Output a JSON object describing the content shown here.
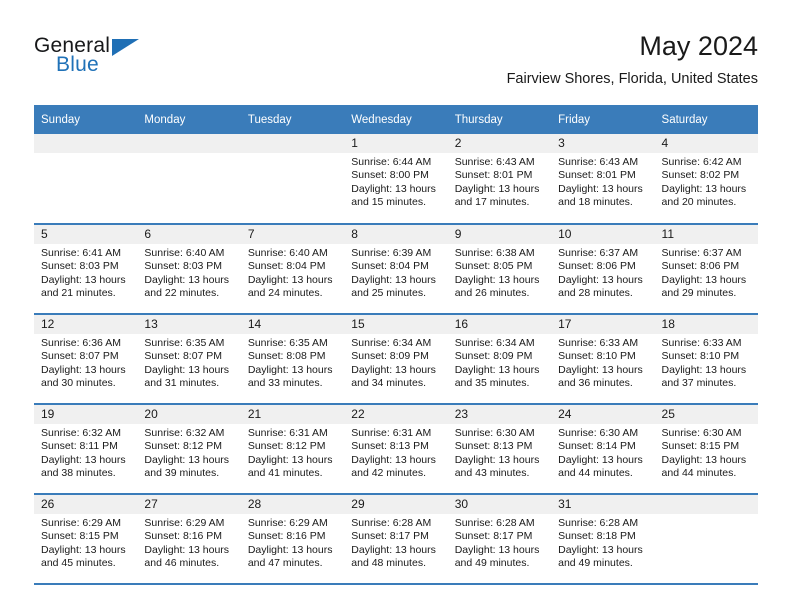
{
  "brand": {
    "name_part1": "General",
    "name_part2": "Blue",
    "triangle_color": "#1f6fb5"
  },
  "header": {
    "month_title": "May 2024",
    "location": "Fairview Shores, Florida, United States"
  },
  "colors": {
    "header_blue": "#3a7cba",
    "daynum_band": "#f0f0f0",
    "text": "#1a1a1a"
  },
  "weekday_headers": [
    "Sunday",
    "Monday",
    "Tuesday",
    "Wednesday",
    "Thursday",
    "Friday",
    "Saturday"
  ],
  "weeks": [
    [
      {
        "day": "",
        "sunrise": "",
        "sunset": "",
        "daylight_line1": "",
        "daylight_line2": "",
        "empty": true
      },
      {
        "day": "",
        "sunrise": "",
        "sunset": "",
        "daylight_line1": "",
        "daylight_line2": "",
        "empty": true
      },
      {
        "day": "",
        "sunrise": "",
        "sunset": "",
        "daylight_line1": "",
        "daylight_line2": "",
        "empty": true
      },
      {
        "day": "1",
        "sunrise": "Sunrise: 6:44 AM",
        "sunset": "Sunset: 8:00 PM",
        "daylight_line1": "Daylight: 13 hours",
        "daylight_line2": "and 15 minutes."
      },
      {
        "day": "2",
        "sunrise": "Sunrise: 6:43 AM",
        "sunset": "Sunset: 8:01 PM",
        "daylight_line1": "Daylight: 13 hours",
        "daylight_line2": "and 17 minutes."
      },
      {
        "day": "3",
        "sunrise": "Sunrise: 6:43 AM",
        "sunset": "Sunset: 8:01 PM",
        "daylight_line1": "Daylight: 13 hours",
        "daylight_line2": "and 18 minutes."
      },
      {
        "day": "4",
        "sunrise": "Sunrise: 6:42 AM",
        "sunset": "Sunset: 8:02 PM",
        "daylight_line1": "Daylight: 13 hours",
        "daylight_line2": "and 20 minutes."
      }
    ],
    [
      {
        "day": "5",
        "sunrise": "Sunrise: 6:41 AM",
        "sunset": "Sunset: 8:03 PM",
        "daylight_line1": "Daylight: 13 hours",
        "daylight_line2": "and 21 minutes."
      },
      {
        "day": "6",
        "sunrise": "Sunrise: 6:40 AM",
        "sunset": "Sunset: 8:03 PM",
        "daylight_line1": "Daylight: 13 hours",
        "daylight_line2": "and 22 minutes."
      },
      {
        "day": "7",
        "sunrise": "Sunrise: 6:40 AM",
        "sunset": "Sunset: 8:04 PM",
        "daylight_line1": "Daylight: 13 hours",
        "daylight_line2": "and 24 minutes."
      },
      {
        "day": "8",
        "sunrise": "Sunrise: 6:39 AM",
        "sunset": "Sunset: 8:04 PM",
        "daylight_line1": "Daylight: 13 hours",
        "daylight_line2": "and 25 minutes."
      },
      {
        "day": "9",
        "sunrise": "Sunrise: 6:38 AM",
        "sunset": "Sunset: 8:05 PM",
        "daylight_line1": "Daylight: 13 hours",
        "daylight_line2": "and 26 minutes."
      },
      {
        "day": "10",
        "sunrise": "Sunrise: 6:37 AM",
        "sunset": "Sunset: 8:06 PM",
        "daylight_line1": "Daylight: 13 hours",
        "daylight_line2": "and 28 minutes."
      },
      {
        "day": "11",
        "sunrise": "Sunrise: 6:37 AM",
        "sunset": "Sunset: 8:06 PM",
        "daylight_line1": "Daylight: 13 hours",
        "daylight_line2": "and 29 minutes."
      }
    ],
    [
      {
        "day": "12",
        "sunrise": "Sunrise: 6:36 AM",
        "sunset": "Sunset: 8:07 PM",
        "daylight_line1": "Daylight: 13 hours",
        "daylight_line2": "and 30 minutes."
      },
      {
        "day": "13",
        "sunrise": "Sunrise: 6:35 AM",
        "sunset": "Sunset: 8:07 PM",
        "daylight_line1": "Daylight: 13 hours",
        "daylight_line2": "and 31 minutes."
      },
      {
        "day": "14",
        "sunrise": "Sunrise: 6:35 AM",
        "sunset": "Sunset: 8:08 PM",
        "daylight_line1": "Daylight: 13 hours",
        "daylight_line2": "and 33 minutes."
      },
      {
        "day": "15",
        "sunrise": "Sunrise: 6:34 AM",
        "sunset": "Sunset: 8:09 PM",
        "daylight_line1": "Daylight: 13 hours",
        "daylight_line2": "and 34 minutes."
      },
      {
        "day": "16",
        "sunrise": "Sunrise: 6:34 AM",
        "sunset": "Sunset: 8:09 PM",
        "daylight_line1": "Daylight: 13 hours",
        "daylight_line2": "and 35 minutes."
      },
      {
        "day": "17",
        "sunrise": "Sunrise: 6:33 AM",
        "sunset": "Sunset: 8:10 PM",
        "daylight_line1": "Daylight: 13 hours",
        "daylight_line2": "and 36 minutes."
      },
      {
        "day": "18",
        "sunrise": "Sunrise: 6:33 AM",
        "sunset": "Sunset: 8:10 PM",
        "daylight_line1": "Daylight: 13 hours",
        "daylight_line2": "and 37 minutes."
      }
    ],
    [
      {
        "day": "19",
        "sunrise": "Sunrise: 6:32 AM",
        "sunset": "Sunset: 8:11 PM",
        "daylight_line1": "Daylight: 13 hours",
        "daylight_line2": "and 38 minutes."
      },
      {
        "day": "20",
        "sunrise": "Sunrise: 6:32 AM",
        "sunset": "Sunset: 8:12 PM",
        "daylight_line1": "Daylight: 13 hours",
        "daylight_line2": "and 39 minutes."
      },
      {
        "day": "21",
        "sunrise": "Sunrise: 6:31 AM",
        "sunset": "Sunset: 8:12 PM",
        "daylight_line1": "Daylight: 13 hours",
        "daylight_line2": "and 41 minutes."
      },
      {
        "day": "22",
        "sunrise": "Sunrise: 6:31 AM",
        "sunset": "Sunset: 8:13 PM",
        "daylight_line1": "Daylight: 13 hours",
        "daylight_line2": "and 42 minutes."
      },
      {
        "day": "23",
        "sunrise": "Sunrise: 6:30 AM",
        "sunset": "Sunset: 8:13 PM",
        "daylight_line1": "Daylight: 13 hours",
        "daylight_line2": "and 43 minutes."
      },
      {
        "day": "24",
        "sunrise": "Sunrise: 6:30 AM",
        "sunset": "Sunset: 8:14 PM",
        "daylight_line1": "Daylight: 13 hours",
        "daylight_line2": "and 44 minutes."
      },
      {
        "day": "25",
        "sunrise": "Sunrise: 6:30 AM",
        "sunset": "Sunset: 8:15 PM",
        "daylight_line1": "Daylight: 13 hours",
        "daylight_line2": "and 44 minutes."
      }
    ],
    [
      {
        "day": "26",
        "sunrise": "Sunrise: 6:29 AM",
        "sunset": "Sunset: 8:15 PM",
        "daylight_line1": "Daylight: 13 hours",
        "daylight_line2": "and 45 minutes."
      },
      {
        "day": "27",
        "sunrise": "Sunrise: 6:29 AM",
        "sunset": "Sunset: 8:16 PM",
        "daylight_line1": "Daylight: 13 hours",
        "daylight_line2": "and 46 minutes."
      },
      {
        "day": "28",
        "sunrise": "Sunrise: 6:29 AM",
        "sunset": "Sunset: 8:16 PM",
        "daylight_line1": "Daylight: 13 hours",
        "daylight_line2": "and 47 minutes."
      },
      {
        "day": "29",
        "sunrise": "Sunrise: 6:28 AM",
        "sunset": "Sunset: 8:17 PM",
        "daylight_line1": "Daylight: 13 hours",
        "daylight_line2": "and 48 minutes."
      },
      {
        "day": "30",
        "sunrise": "Sunrise: 6:28 AM",
        "sunset": "Sunset: 8:17 PM",
        "daylight_line1": "Daylight: 13 hours",
        "daylight_line2": "and 49 minutes."
      },
      {
        "day": "31",
        "sunrise": "Sunrise: 6:28 AM",
        "sunset": "Sunset: 8:18 PM",
        "daylight_line1": "Daylight: 13 hours",
        "daylight_line2": "and 49 minutes."
      },
      {
        "day": "",
        "sunrise": "",
        "sunset": "",
        "daylight_line1": "",
        "daylight_line2": "",
        "empty": true
      }
    ]
  ]
}
